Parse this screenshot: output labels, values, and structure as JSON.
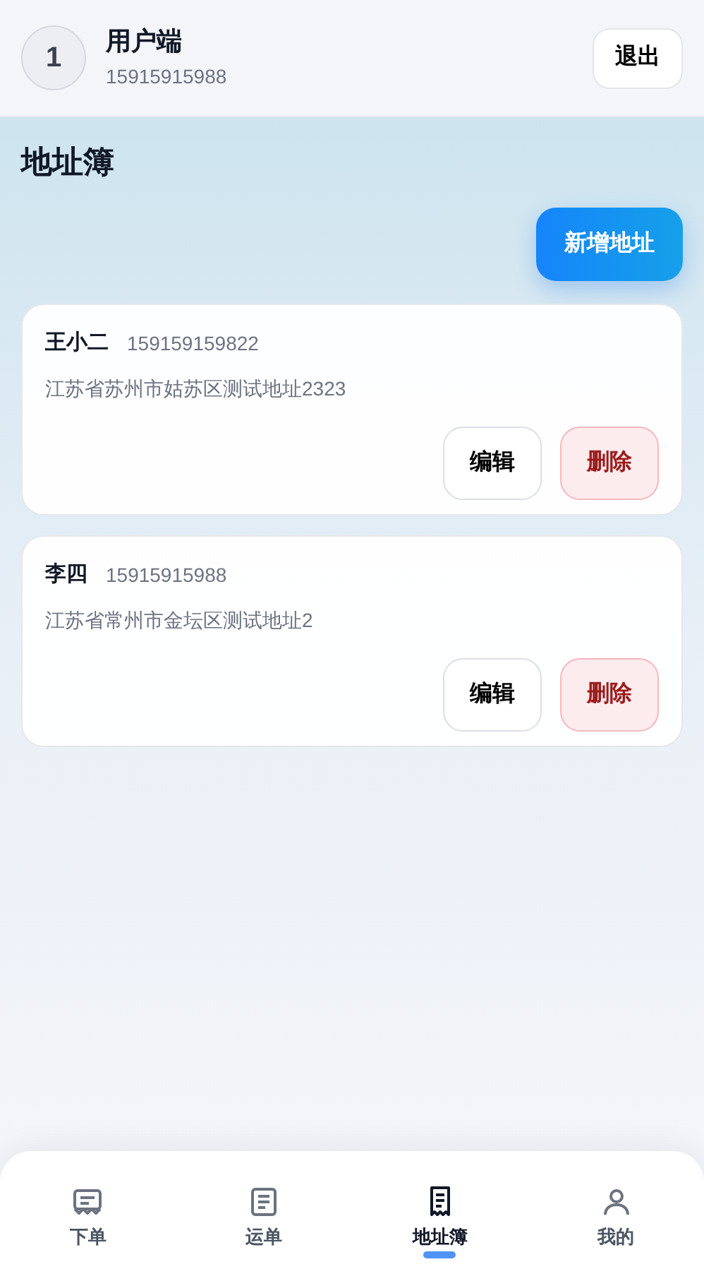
{
  "header": {
    "avatar": "1",
    "title": "用户端",
    "phone": "15915915988",
    "logout": "退出"
  },
  "page": {
    "title": "地址簿",
    "add_button": "新增地址"
  },
  "addresses": [
    {
      "name": "王小二",
      "phone": "159159159822",
      "address": "江苏省苏州市姑苏区测试地址2323",
      "edit": "编辑",
      "delete": "删除"
    },
    {
      "name": "李四",
      "phone": "15915915988",
      "address": "江苏省常州市金坛区测试地址2",
      "edit": "编辑",
      "delete": "删除"
    }
  ],
  "tab_bar": [
    {
      "label": "下单",
      "selected": false
    },
    {
      "label": "运单",
      "selected": false
    },
    {
      "label": "地址簿",
      "selected": true
    },
    {
      "label": "我的",
      "selected": false
    }
  ]
}
